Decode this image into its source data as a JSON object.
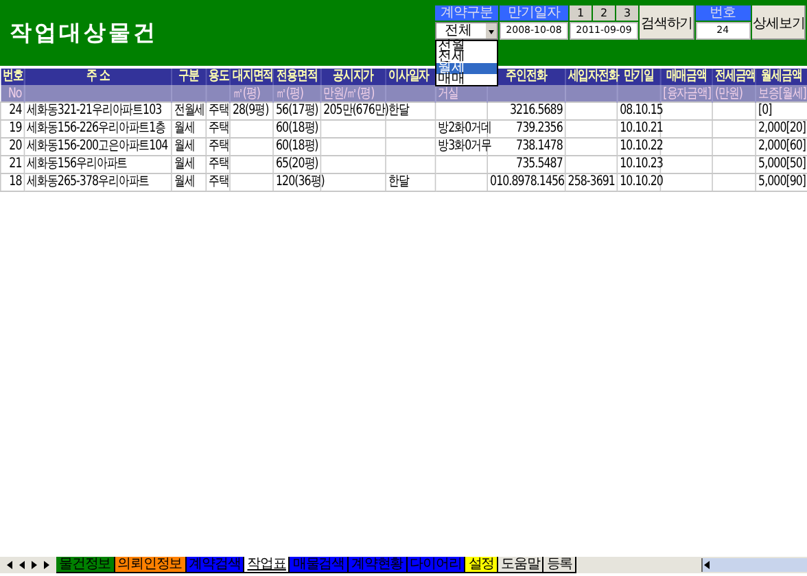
{
  "title": "작업대상물건",
  "filters": {
    "contract_type": {
      "label": "계약구분",
      "value": "전체",
      "options": [
        {
          "label": "전월",
          "selected": false
        },
        {
          "label": "전세",
          "selected": false
        },
        {
          "label": "월세",
          "selected": true
        },
        {
          "label": "매매",
          "selected": false
        }
      ]
    },
    "expiry": {
      "label": "만기일자",
      "from": "2008-10-08",
      "to": "2011-09-09",
      "presets": [
        "1",
        "2",
        "3"
      ]
    },
    "search_button": "검색하기",
    "number": {
      "label": "번호",
      "value": "24"
    },
    "detail_button": "상세보기"
  },
  "table": {
    "columns": [
      {
        "label": "번호",
        "sub": "No"
      },
      {
        "label": "주 소"
      },
      {
        "label": "구분"
      },
      {
        "label": "용도"
      },
      {
        "label": "대지면적",
        "sub": "㎡(평)"
      },
      {
        "label": "전용면적",
        "sub": "㎡(평)"
      },
      {
        "label": "공시지가",
        "sub": "만원/㎡(평)"
      },
      {
        "label": "이사일자"
      },
      {
        "sub": "거실"
      },
      {
        "label": "주인전화"
      },
      {
        "label": "세입자전화"
      },
      {
        "label": "만기일"
      },
      {
        "label": "매매금액",
        "sub": "[융자금액]"
      },
      {
        "label": "전세금액",
        "sub": "(만원)"
      },
      {
        "label": "월세금액",
        "sub": "보증[월세]"
      }
    ],
    "rows": [
      [
        "24",
        "세화동321-21우리아파트103",
        "전월세",
        "주택",
        "28(9평)",
        "56(17평)",
        "205만(676만)",
        "한달",
        null,
        "3216.5689",
        null,
        "08.10.15",
        null,
        null,
        "[0]"
      ],
      [
        "19",
        "세화동156-226우리아파트1층",
        "월세",
        "주택",
        null,
        "60(18평)",
        null,
        null,
        "방2화0거데",
        "739.2356",
        null,
        "10.10.21",
        null,
        null,
        "2,000[20]"
      ],
      [
        "20",
        "세화동156-200고은아파트104",
        "월세",
        "주택",
        null,
        "60(18평)",
        null,
        null,
        "방3화0거무",
        "738.1478",
        null,
        "10.10.22",
        null,
        null,
        "2,000[60]"
      ],
      [
        "21",
        "세화동156우리아파트",
        "월세",
        "주택",
        null,
        "65(20평)",
        null,
        null,
        null,
        "735.5487",
        null,
        "10.10.23",
        null,
        null,
        "5,000[50]"
      ],
      [
        "18",
        "세화동265-378우리아파트",
        "월세",
        "주택",
        null,
        "120(36평)",
        null,
        "한달",
        null,
        "010.8978.1456",
        "258-3691",
        "10.10.20",
        null,
        null,
        "5,000[90]"
      ]
    ]
  },
  "sheet_tabs": [
    {
      "label": "물건정보",
      "color": "#008000",
      "selected": false
    },
    {
      "label": "의뢰인정보",
      "color": "#ff8000",
      "selected": false
    },
    {
      "label": "계약검색",
      "color": "#0000ff",
      "selected": false
    },
    {
      "label": "작업표",
      "selected": true
    },
    {
      "label": "매물검색",
      "color": "#0000ff",
      "selected": false
    },
    {
      "label": "계약현황",
      "color": "#0000ff",
      "selected": false
    },
    {
      "label": "다이어리",
      "color": "#0000ff",
      "selected": false
    },
    {
      "label": "설정",
      "color": "#ffff00",
      "selected": false
    },
    {
      "label": "도움말",
      "selected": false
    },
    {
      "label": "등록",
      "selected": false
    }
  ]
}
